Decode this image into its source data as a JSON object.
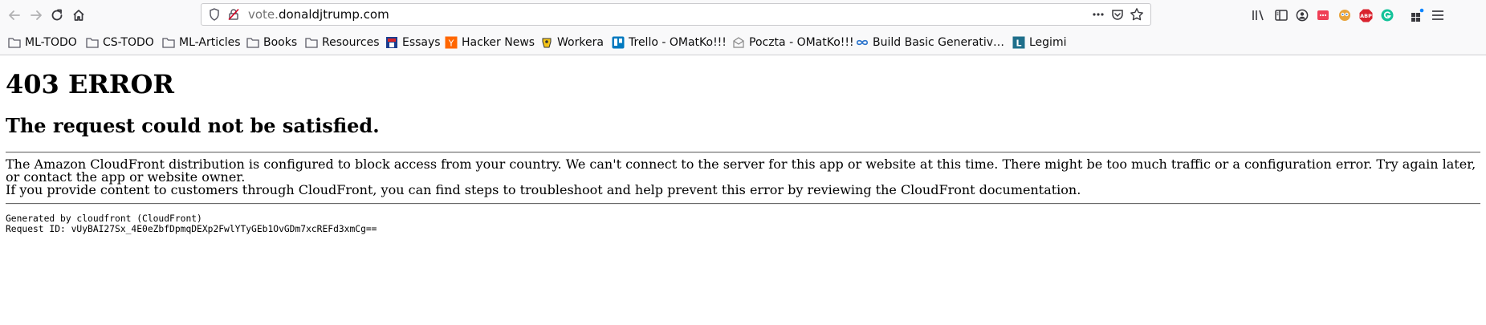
{
  "browser": {
    "url": {
      "prefix": "vote.",
      "domain": "donaldjtrump.com"
    },
    "bookmarks": [
      {
        "label": "ML-TODO",
        "icon": "folder-icon"
      },
      {
        "label": "CS-TODO",
        "icon": "folder-icon"
      },
      {
        "label": "ML-Articles",
        "icon": "folder-icon"
      },
      {
        "label": "Books",
        "icon": "folder-icon"
      },
      {
        "label": "Resources",
        "icon": "folder-icon"
      },
      {
        "label": "Essays",
        "icon": "essays-favicon"
      },
      {
        "label": "Hacker News",
        "icon": "hacker-news-favicon"
      },
      {
        "label": "Workera",
        "icon": "workera-favicon"
      },
      {
        "label": "Trello - OMatKo!!!",
        "icon": "trello-favicon"
      },
      {
        "label": "Poczta - OMatKo!!!",
        "icon": "mail-favicon"
      },
      {
        "label": "Build Basic Generativ…",
        "icon": "coursera-favicon"
      },
      {
        "label": "Legimi",
        "icon": "legimi-favicon"
      }
    ],
    "extensions": {
      "abp_label": "ABP",
      "legimi_letter": "L",
      "hn_letter": "Y"
    },
    "colors": {
      "hacker_news": "#ff6600",
      "trello": "#0079bf",
      "abp": "#d9232e",
      "grammarly": "#15c39a",
      "legimi": "#1f6f8b"
    }
  },
  "page": {
    "heading": "403 ERROR",
    "subheading": "The request could not be satisfied.",
    "paragraph1": "The Amazon CloudFront distribution is configured to block access from your country. We can't connect to the server for this app or website at this time. There might be too much traffic or a configuration error. Try again later, or contact the app or website owner.",
    "paragraph2": "If you provide content to customers through CloudFront, you can find steps to troubleshoot and help prevent this error by reviewing the CloudFront documentation.",
    "generated_by": "Generated by cloudfront (CloudFront)",
    "request_id": "Request ID: vUyBAI27Sx_4E0eZbfDpmqDEXp2FwlYTyGEb1OvGDm7xcREFd3xmCg=="
  }
}
